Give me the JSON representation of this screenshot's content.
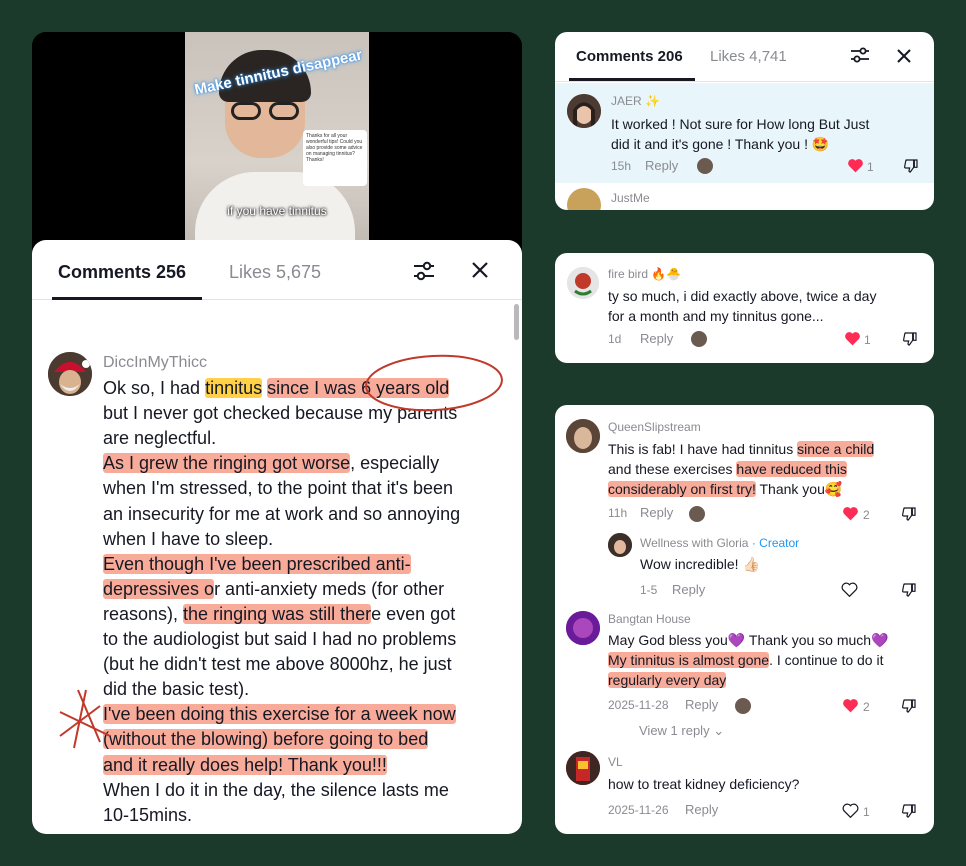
{
  "video": {
    "title_overlay": "Make tinnitus disappear",
    "caption": "if you have tinnitus",
    "bubble_text": "Thanks for all your wonderful tips! Could you also provide some advice on managing tinnitus? Thanks!"
  },
  "main_panel": {
    "tabs": [
      {
        "label": "Comments 256"
      },
      {
        "label": "Likes 5,675"
      }
    ],
    "comment": {
      "username": "DiccInMyThicc",
      "lines": [
        "Ok so, I had tinnitus since I was 6 years old",
        "but I never got checked because my parents",
        "are neglectful.",
        "As I grew the ringing got worse, especially",
        "when I'm stressed, to the point that it's been",
        "an insecurity for me at work and so annoying",
        "when I have to sleep.",
        "Even though I've been prescribed anti-",
        "depressives or anti-anxiety meds (for other",
        "reasons), the ringing was still there even got",
        "to the audiologist but said I had no problems",
        "(but he didn't test me above 8000hz, he just",
        "did the basic test).",
        "I've been doing this exercise for a week now",
        "(without the blowing) before going to bed",
        "and it really does help! Thank you!!!",
        "When I do it in the day, the silence lasts me",
        "10-15mins."
      ]
    }
  },
  "card1": {
    "tabs": [
      {
        "label": "Comments 206"
      },
      {
        "label": "Likes 4,741"
      }
    ],
    "comment": {
      "username": "JAER ✨",
      "text_line1": "It worked ! Not sure for How long But Just",
      "text_line2": "did it and it's gone ! Thank you ! 🤩",
      "time": "15h",
      "reply": "Reply",
      "likes": "1"
    },
    "next_username": "JustMe"
  },
  "card2": {
    "comment": {
      "username": "fire bird 🔥🐣",
      "text_line1": "ty so much, i did exactly above, twice a day",
      "text_line2": "for a month and my tinnitus gone...",
      "time": "1d",
      "reply": "Reply",
      "likes": "1"
    }
  },
  "card3": {
    "comments": [
      {
        "username": "QueenSlipstream",
        "line1": "This is fab! I have had tinnitus since a child",
        "line2": "and these exercises have reduced this",
        "line3": "considerably on first try! Thank you🥰",
        "time": "11h",
        "reply": "Reply",
        "likes": "2"
      },
      {
        "username": "Wellness with Gloria",
        "badge": "· Creator",
        "line1": "Wow incredible! 👍🏻",
        "time": "1-5",
        "reply": "Reply"
      },
      {
        "username": "Bangtan House",
        "line1": "May God bless you💜 Thank you so much💜",
        "line2": "My tinnitus is almost gone. I continue to do it",
        "line3": "regularly every day",
        "time": "2025-11-28",
        "reply": "Reply",
        "likes": "2",
        "view_replies": "View 1 reply"
      },
      {
        "username": "VL",
        "line1": "how to treat kidney deficiency?",
        "time": "2025-11-26",
        "reply": "Reply",
        "likes": "1"
      }
    ]
  },
  "colors": {
    "background": "#1b3a2c",
    "highlight": "#f6785c",
    "annotation_red": "#c0392b",
    "annotation_yellow": "#f2b705",
    "heart": "#fe2c55",
    "creator": "#2196f3"
  }
}
